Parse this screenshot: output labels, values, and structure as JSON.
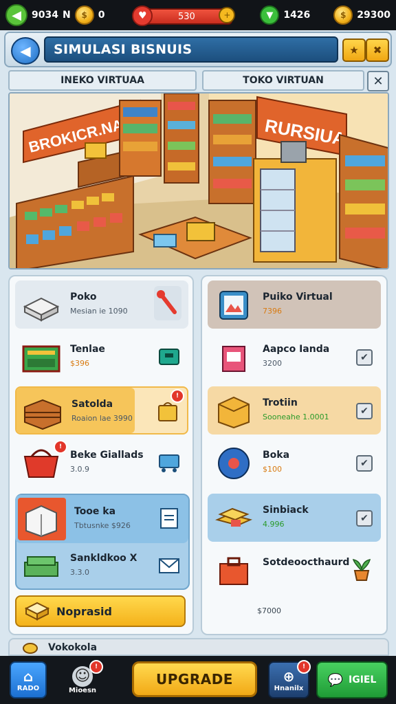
{
  "topbar": {
    "left_value": "9034",
    "left_label": "N",
    "coin_left_value": "0",
    "health_value": "530",
    "green_value": "1426",
    "coin_right_value": "29300"
  },
  "title": {
    "text": "SIMULASI BISNUIS"
  },
  "tabs": {
    "left": "INEKO VIRTUAA",
    "right": "TOKO VIRTUAN"
  },
  "scene": {
    "sign_left": "BROKICR.NAIIS",
    "sign_right": "RURSIUA"
  },
  "left_list": [
    {
      "name": "Poko",
      "sub": "Mesian ie 1090",
      "sub_style": "",
      "icon": "wrench-icon"
    },
    {
      "name": "Tenlae",
      "sub": "$396",
      "sub_style": "orange",
      "icon": "cash-register-icon"
    },
    {
      "name": "Satolda",
      "sub": "Roaion lae 3990",
      "sub_style": "",
      "icon": "bag-icon",
      "badge": "!"
    },
    {
      "name": "Beke Giallads",
      "sub": "3.0.9",
      "sub_style": "",
      "icon": "cart-icon"
    },
    {
      "name": "Tooe ka",
      "sub": "Tbtusnke $926",
      "sub_style": "",
      "icon": "document-icon"
    },
    {
      "name": "Sankldkoo X",
      "sub": "3.3.0",
      "sub_style": "",
      "icon": "mail-icon"
    }
  ],
  "left_button": "Noprasid",
  "right_list": [
    {
      "name": "Puiko Virtual",
      "sub": "7396",
      "sub_style": "orange"
    },
    {
      "name": "Aapco Ianda",
      "sub": "3200",
      "sub_style": ""
    },
    {
      "name": "Trotiin",
      "sub": "Sooneahe 1.0001",
      "sub_style": "green"
    },
    {
      "name": "Boka",
      "sub": "$100",
      "sub_style": "orange"
    },
    {
      "name": "Sinbiack",
      "sub": "4.996",
      "sub_style": "green"
    },
    {
      "name": "Sotdeoocthaurd",
      "sub": "",
      "sub_style": ""
    }
  ],
  "right_footer_value": "$7000",
  "peek_label": "Vokokola",
  "bottom": {
    "home": "RADO",
    "mission": "Mioesn",
    "upgrade": "UPGRADE",
    "harvest": "Hnanilx",
    "chat": "IGIEL",
    "badge": "!"
  },
  "colors": {
    "title_bar": "#2f6ea5",
    "accent_yellow": "#f4b21b",
    "selected_blue": "#9fcaea",
    "selected_orange": "#f6d9a4"
  }
}
